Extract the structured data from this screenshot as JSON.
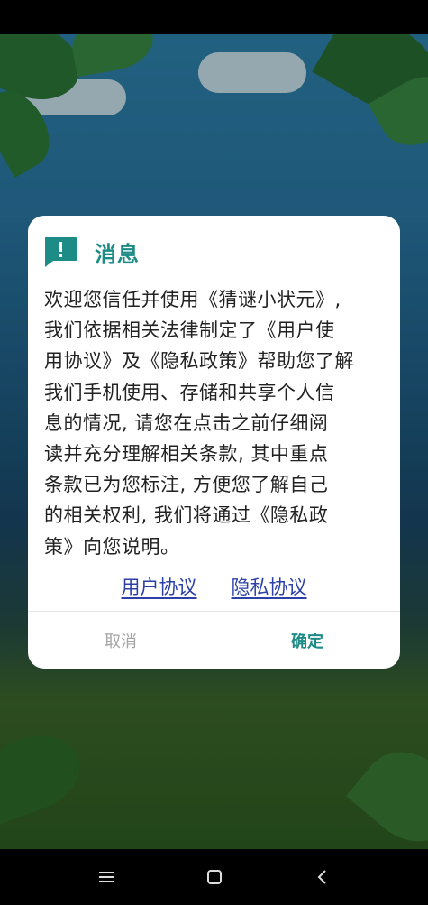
{
  "dialog": {
    "title": "消息",
    "icon": "message-alert-icon",
    "accent_color": "#1d8b86",
    "body_lines": [
      "欢迎您信任并使用《猜谜小状元》,",
      "我们依据相关法律制定了《用户使",
      "用协议》及《隐私政策》帮助您了解",
      "我们手机使用、存储和共享个人信",
      "息的情况, 请您在点击之前仔细阅",
      "读并充分理解相关条款, 其中重点",
      "条款已为您标注, 方便您了解自己",
      "的相关权利, 我们将通过《隐私政",
      "策》向您说明。"
    ],
    "links": {
      "user_agreement": "用户协议",
      "privacy_agreement": "隐私协议"
    },
    "buttons": {
      "cancel": "取消",
      "confirm": "确定"
    }
  },
  "nav": {
    "menu_icon": "menu-icon",
    "home_icon": "home-icon",
    "back_icon": "back-icon"
  }
}
